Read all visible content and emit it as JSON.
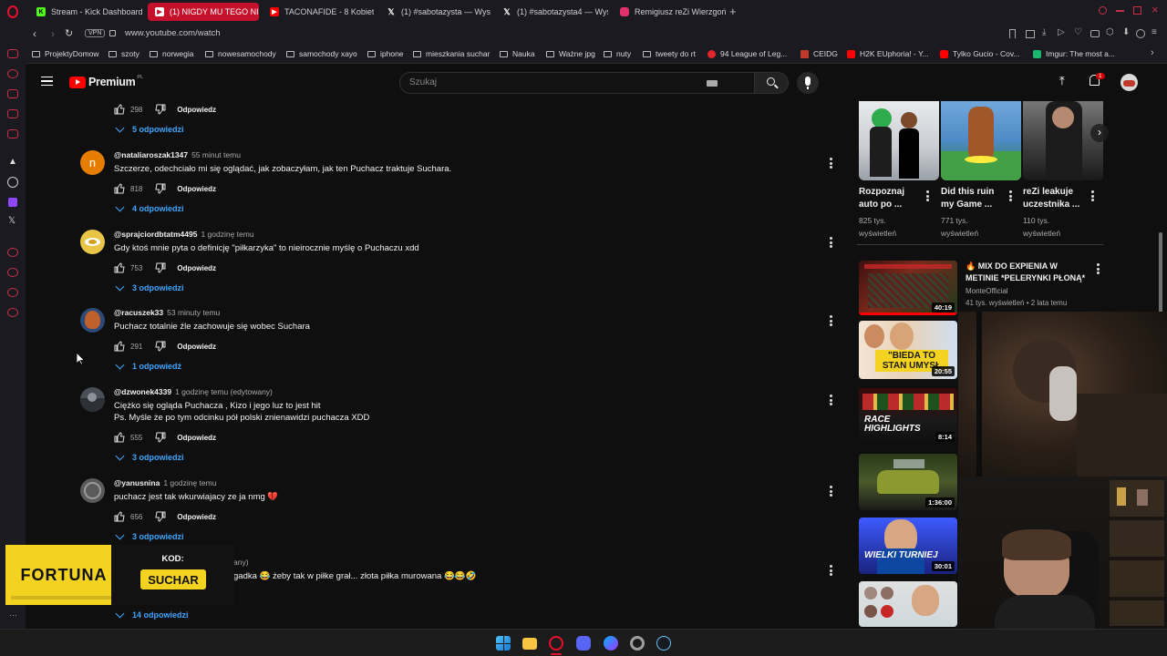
{
  "browser": {
    "tabs": [
      {
        "label": "Stream - Kick Dashboard",
        "icon": "kick-icon",
        "color": "#53fc18"
      },
      {
        "label": "(1) NIGDY MU TEGO NIE",
        "icon": "youtube-icon",
        "color": "#ff0000",
        "active": true
      },
      {
        "label": "TACONAFIDE - 8 Kobiet",
        "icon": "youtube-icon",
        "color": "#ff0000"
      },
      {
        "label": "(1) #sabotazysta — Wys",
        "icon": "x-icon",
        "color": "#ffffff"
      },
      {
        "label": "(1) #sabotazysta4 — Wys",
        "icon": "x-icon",
        "color": "#ffffff"
      },
      {
        "label": "Remigiusz reZi Wierzgoń",
        "icon": "instagram-icon",
        "color": "#e1306c"
      }
    ],
    "vpn_label": "VPN",
    "url": "www.youtube.com/watch",
    "bookmarks": [
      {
        "label": "ProjektyDomow",
        "type": "folder"
      },
      {
        "label": "szoty",
        "type": "folder"
      },
      {
        "label": "norwegia",
        "type": "folder"
      },
      {
        "label": "nowesamochody",
        "type": "folder"
      },
      {
        "label": "samochody xayo",
        "type": "folder"
      },
      {
        "label": "iphone",
        "type": "folder"
      },
      {
        "label": "mieszkania suchar",
        "type": "folder"
      },
      {
        "label": "Nauka",
        "type": "folder"
      },
      {
        "label": "Ważne jpg",
        "type": "folder"
      },
      {
        "label": "nuty",
        "type": "folder"
      },
      {
        "label": "tweety do rt",
        "type": "folder"
      },
      {
        "label": "94 League of Leg...",
        "type": "site",
        "color": "#e0262a"
      },
      {
        "label": "CEIDG",
        "type": "site",
        "color": "#c0392b"
      },
      {
        "label": "H2K EUphoria! - Y...",
        "type": "site",
        "color": "#ff0000"
      },
      {
        "label": "Tylko Gucio - Cov...",
        "type": "site",
        "color": "#ff0000"
      },
      {
        "label": "Imgur: The most a...",
        "type": "site",
        "color": "#1bb76e"
      }
    ]
  },
  "youtube": {
    "logo_text": "Premium",
    "logo_sup": "PL",
    "search_placeholder": "Szukaj",
    "notifications_count": "1"
  },
  "comments": {
    "first_likes": "298",
    "first_reply": "Odpowiedz",
    "first_replies": "5 odpowiedzi",
    "items": [
      {
        "author": "@nataliaroszak1347",
        "time": "55 minut temu",
        "text": "Szczerze, odechciało mi się oglądać, jak zobaczyłam, jak ten Puchacz traktuje Suchara.",
        "likes": "818",
        "reply": "Odpowiedz",
        "replies": "4 odpowiedzi",
        "avatar_color": "#e67c00",
        "avatar_letter": "n"
      },
      {
        "author": "@sprajciordbtatm4495",
        "time": "1 godzinę temu",
        "text": "Gdy ktoś mnie pyta o definicję \"piłkarzyka\" to nieirocznie myślę o Puchaczu xdd",
        "likes": "753",
        "reply": "Odpowiedz",
        "replies": "3 odpowiedzi",
        "avatar_color": "#e8c547"
      },
      {
        "author": "@racuszek33",
        "time": "53 minuty temu",
        "text": "Puchacz totalnie źle zachowuje się wobec Suchara",
        "likes": "291",
        "reply": "Odpowiedz",
        "replies": "1 odpowiedź",
        "avatar_color": "#c0612b"
      },
      {
        "author": "@dzwonek4339",
        "time": "1 godzinę temu (edytowany)",
        "text": "Ciężko się ogląda Puchacza , Kizo i jego luz to jest hit",
        "text2": "Ps. Myśle że po tym odcinku pół polski znienawidzi puchacza XDD",
        "likes": "555",
        "reply": "Odpowiedz",
        "replies": "3 odpowiedzi",
        "avatar_color": "#4a4f57"
      },
      {
        "author": "@yanusnina",
        "time": "1 godzinę temu",
        "text": "puchacz jest tak wkurwiajacy ze ja nmg 💔",
        "likes": "656",
        "reply": "Odpowiedz",
        "replies": "3 odpowiedzi",
        "avatar_color": "#5a5a5a"
      }
    ],
    "last_partial_time": "any)",
    "last_partial_text": "gadka 😂 żeby tak w piłke grał... złota piłka murowana 😂😂🤣",
    "last_replies": "14 odpowiedzi"
  },
  "shorts": [
    {
      "title_1": "Rozpoznaj",
      "title_2": "auto po ...",
      "views_1": "825 tys.",
      "views_2": "wyświetleń"
    },
    {
      "title_1": "Did this ruin",
      "title_2": "my Game ...",
      "views_1": "771 tys.",
      "views_2": "wyświetleń"
    },
    {
      "title_1": "reZi leakuje",
      "title_2": "uczestnika ...",
      "views_1": "110 tys.",
      "views_2": "wyświetleń"
    }
  ],
  "recommended": [
    {
      "title_1": "🔥 MIX DO EXPIENIA  W",
      "title_2": "METINIE *PELERYNKI PŁONĄ*",
      "channel": "MonteOfficial",
      "meta": "41 tys. wyświetleń • 2 lata temu",
      "duration": "40:19",
      "progress": 1.0
    },
    {
      "duration": "20:55",
      "overlay": "\"BIEDA TO\nSTAN UMYSŁ"
    },
    {
      "duration": "8:14",
      "overlay": "RACE\nHIGHLIGHTS"
    },
    {
      "duration": "1:36:00"
    },
    {
      "duration": "30:01",
      "overlay": "WIELKI TURNIEJ"
    },
    {
      "duration": ""
    }
  ],
  "promo": {
    "brand": "FORTUNA",
    "code_label": "KOD:",
    "code": "SUCHAR"
  },
  "colors": {
    "accent_red": "#ff0000",
    "link_blue": "#3ea6ff",
    "promo_yellow": "#f4d320"
  }
}
